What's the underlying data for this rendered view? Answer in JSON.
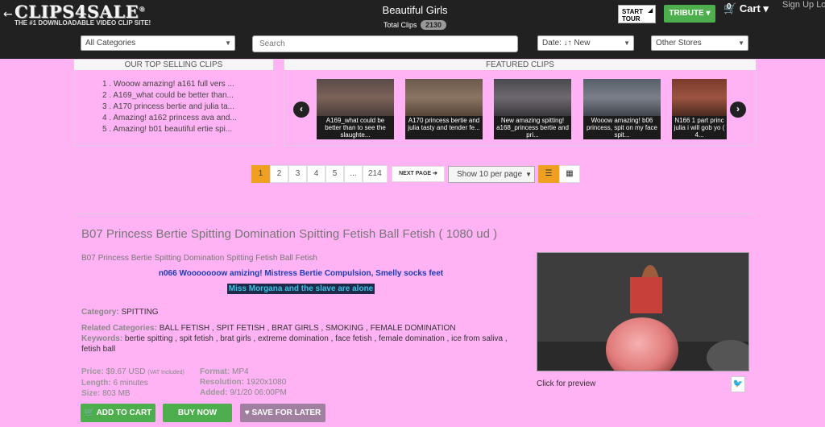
{
  "header": {
    "back_arrow": "←",
    "logo_text": "CLIPS4SALE",
    "logo_mark": "®",
    "logo_tagline": "THE #1 DOWNLOADABLE VIDEO CLIP SITE!",
    "site_title": "Beautiful Girls",
    "total_clips_label": "Total Clips",
    "total_clips_count": "2130",
    "start_tour": "START TOUR",
    "tribute_label": "TRIBUTE ▾",
    "cart_count": "0",
    "cart_label": "Cart ▾",
    "signup_label": "Sign Up Log"
  },
  "filters": {
    "categories": "All Categories",
    "search_placeholder": "Search",
    "date_sort": "Date: ↓↑ New",
    "other_stores": "Other Stores"
  },
  "top_selling": {
    "title": "OUR TOP SELLING CLIPS",
    "items": [
      "1 . Wooow amazing! a161 full vers ...",
      "2 . A169_what could be better than...",
      "3 . A170 princess bertie and julia ta...",
      "4 . Amazing! a162 princess ava and...",
      "5 . Amazing! b01 beautiful ertie spi..."
    ]
  },
  "featured": {
    "title": "FEATURED CLIPS",
    "prev": "‹",
    "next": "›",
    "clips": [
      {
        "caption": "A169_what could be better than to see the slaughte..."
      },
      {
        "caption": "A170 princess bertie and julia tasty and tender fe..."
      },
      {
        "caption": "New amazing spitting! a168_princess bertie and pri..."
      },
      {
        "caption": "Wooow amazing! b06 princess, spit on my face spit..."
      },
      {
        "caption": "N166 1 part princ julia i will gob yo ( 4..."
      }
    ]
  },
  "pagination": {
    "pages": [
      "1",
      "2",
      "3",
      "4",
      "5",
      "...",
      "214"
    ],
    "next_label": "NEXT PAGE ➔",
    "per_page": "Show 10 per page",
    "list_icon": "☰",
    "grid_icon": "▦"
  },
  "product": {
    "title": "B07 Princess Bertie Spitting Domination Spitting Fetish Ball Fetish ( 1080 ud )",
    "subtitle": "B07 Princess Bertie Spitting Domination Spitting Fetish Ball Fetish",
    "promo1": "n066 Wooooooow amizing! Mistress Bertie Compulsion, Smelly socks feet",
    "promo2": "Miss Morgana and the slave are alone",
    "category_label": "Category:",
    "category": "SPITTING",
    "related_label": "Related Categories:",
    "related": "BALL FETISH , SPIT FETISH , BRAT GIRLS , SMOKING , FEMALE DOMINATION",
    "keywords_label": "Keywords:",
    "keywords": "bertie spitting , spit fetish , brat girls , extreme domination , face fetish , female domination , ice from saliva ,",
    "keywords2": "fetish ball",
    "price_label": "Price:",
    "price": "$9.67 USD",
    "vat": "(VAT Included)",
    "length_label": "Length:",
    "length": "6 minutes",
    "size_label": "Size:",
    "size": "803 MB",
    "format_label": "Format:",
    "format": "MP4",
    "resolution_label": "Resolution:",
    "resolution": "1920x1080",
    "added_label": "Added:",
    "added": "9/1/20 06:00PM",
    "add_to_cart": "🛒 ADD TO CART",
    "buy_now": "BUY NOW",
    "save_later": "♥ SAVE FOR LATER",
    "preview_caption": "Click for preview",
    "twitter_icon": "🐦"
  }
}
